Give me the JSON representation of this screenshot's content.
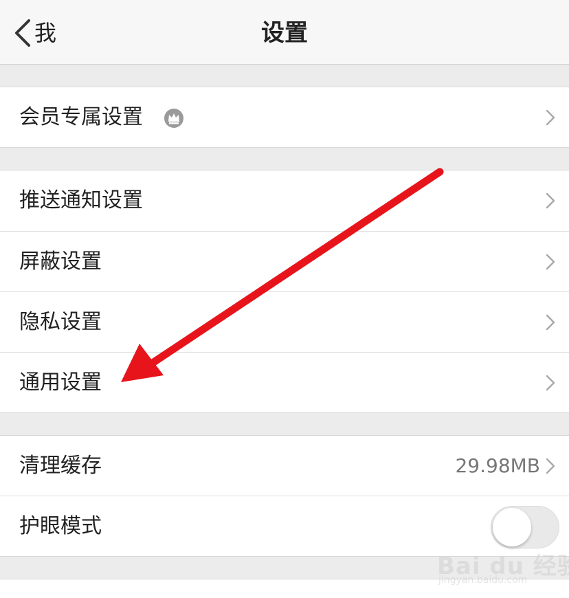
{
  "navbar": {
    "back_label": "我",
    "title": "设置"
  },
  "sections": {
    "vip": {
      "label": "会员专属设置"
    },
    "notify": {
      "label": "推送通知设置"
    },
    "block": {
      "label": "屏蔽设置"
    },
    "privacy": {
      "label": "隐私设置"
    },
    "general": {
      "label": "通用设置"
    },
    "cache": {
      "label": "清理缓存",
      "value": "29.98MB"
    },
    "eyecare": {
      "label": "护眼模式",
      "enabled": false
    }
  },
  "annotation": {
    "color": "#e8141b"
  },
  "watermark": {
    "text": "Bai du 经验",
    "sub": "jingyan.baidu.com"
  },
  "colors": {
    "background": "#ececec",
    "row": "#ffffff",
    "navbar": "#f7f7f7"
  }
}
